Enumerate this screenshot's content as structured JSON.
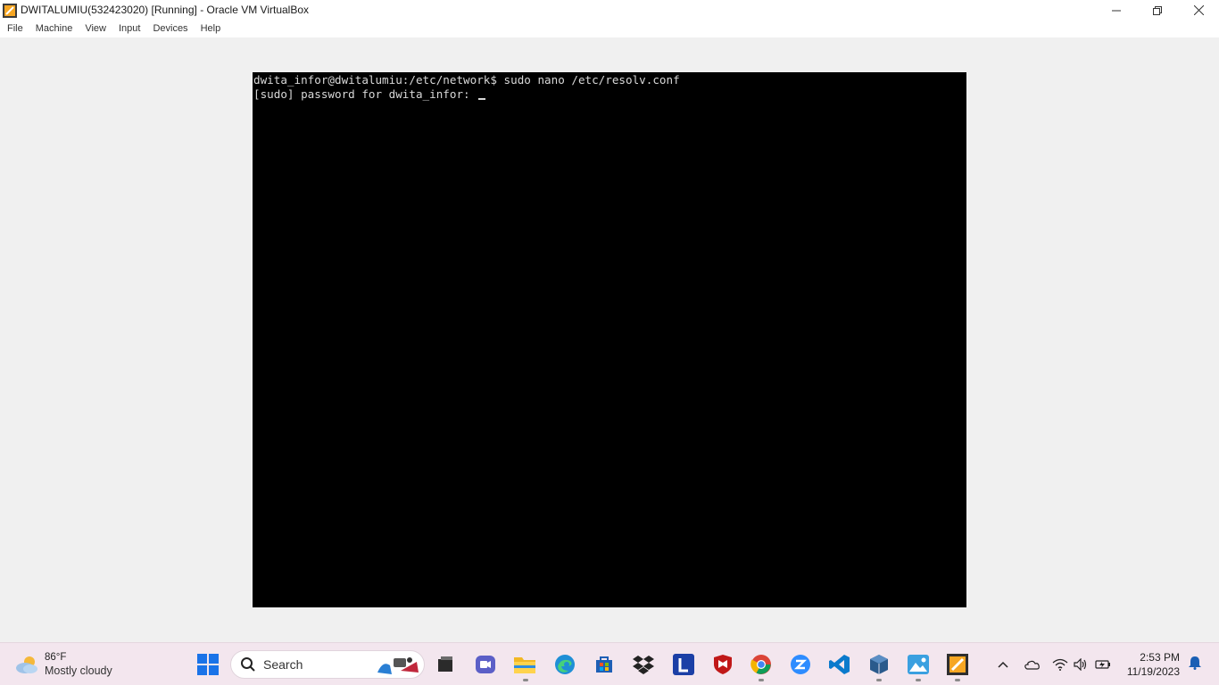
{
  "window": {
    "title": "DWITALUMIU(532423020) [Running] - Oracle VM VirtualBox",
    "controls": [
      "minimize",
      "restore",
      "close"
    ]
  },
  "menu": [
    "File",
    "Machine",
    "View",
    "Input",
    "Devices",
    "Help"
  ],
  "terminal": {
    "lines": [
      "dwita_infor@dwitalumiu:/etc/network$ sudo nano /etc/resolv.conf",
      "[sudo] password for dwita_infor: "
    ]
  },
  "taskbar": {
    "weather": {
      "temp": "86°F",
      "condition": "Mostly cloudy"
    },
    "search_label": "Search",
    "apps": [
      "file-manager",
      "meet",
      "file-explorer",
      "edge",
      "store",
      "dropbox",
      "l-app",
      "mcafee",
      "chrome",
      "zoom",
      "vscode",
      "virtualbox-manager",
      "photos",
      "virtualbox-vm"
    ],
    "clock": {
      "time": "2:53 PM",
      "date": "11/19/2023"
    }
  },
  "colors": {
    "taskbar_bg": "#f3e6ee",
    "vm_bg": "#f0f0f0",
    "terminal_bg": "#000000",
    "terminal_fg": "#d8d8d8"
  }
}
